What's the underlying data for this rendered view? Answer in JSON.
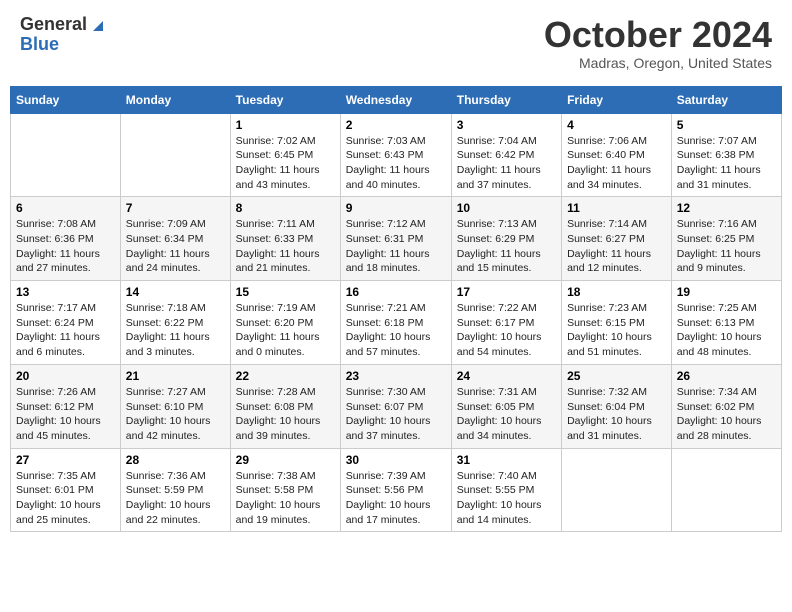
{
  "logo": {
    "general": "General",
    "blue": "Blue"
  },
  "title": "October 2024",
  "subtitle": "Madras, Oregon, United States",
  "days_of_week": [
    "Sunday",
    "Monday",
    "Tuesday",
    "Wednesday",
    "Thursday",
    "Friday",
    "Saturday"
  ],
  "weeks": [
    [
      {
        "day": "",
        "detail": ""
      },
      {
        "day": "",
        "detail": ""
      },
      {
        "day": "1",
        "detail": "Sunrise: 7:02 AM\nSunset: 6:45 PM\nDaylight: 11 hours and 43 minutes."
      },
      {
        "day": "2",
        "detail": "Sunrise: 7:03 AM\nSunset: 6:43 PM\nDaylight: 11 hours and 40 minutes."
      },
      {
        "day": "3",
        "detail": "Sunrise: 7:04 AM\nSunset: 6:42 PM\nDaylight: 11 hours and 37 minutes."
      },
      {
        "day": "4",
        "detail": "Sunrise: 7:06 AM\nSunset: 6:40 PM\nDaylight: 11 hours and 34 minutes."
      },
      {
        "day": "5",
        "detail": "Sunrise: 7:07 AM\nSunset: 6:38 PM\nDaylight: 11 hours and 31 minutes."
      }
    ],
    [
      {
        "day": "6",
        "detail": "Sunrise: 7:08 AM\nSunset: 6:36 PM\nDaylight: 11 hours and 27 minutes."
      },
      {
        "day": "7",
        "detail": "Sunrise: 7:09 AM\nSunset: 6:34 PM\nDaylight: 11 hours and 24 minutes."
      },
      {
        "day": "8",
        "detail": "Sunrise: 7:11 AM\nSunset: 6:33 PM\nDaylight: 11 hours and 21 minutes."
      },
      {
        "day": "9",
        "detail": "Sunrise: 7:12 AM\nSunset: 6:31 PM\nDaylight: 11 hours and 18 minutes."
      },
      {
        "day": "10",
        "detail": "Sunrise: 7:13 AM\nSunset: 6:29 PM\nDaylight: 11 hours and 15 minutes."
      },
      {
        "day": "11",
        "detail": "Sunrise: 7:14 AM\nSunset: 6:27 PM\nDaylight: 11 hours and 12 minutes."
      },
      {
        "day": "12",
        "detail": "Sunrise: 7:16 AM\nSunset: 6:25 PM\nDaylight: 11 hours and 9 minutes."
      }
    ],
    [
      {
        "day": "13",
        "detail": "Sunrise: 7:17 AM\nSunset: 6:24 PM\nDaylight: 11 hours and 6 minutes."
      },
      {
        "day": "14",
        "detail": "Sunrise: 7:18 AM\nSunset: 6:22 PM\nDaylight: 11 hours and 3 minutes."
      },
      {
        "day": "15",
        "detail": "Sunrise: 7:19 AM\nSunset: 6:20 PM\nDaylight: 11 hours and 0 minutes."
      },
      {
        "day": "16",
        "detail": "Sunrise: 7:21 AM\nSunset: 6:18 PM\nDaylight: 10 hours and 57 minutes."
      },
      {
        "day": "17",
        "detail": "Sunrise: 7:22 AM\nSunset: 6:17 PM\nDaylight: 10 hours and 54 minutes."
      },
      {
        "day": "18",
        "detail": "Sunrise: 7:23 AM\nSunset: 6:15 PM\nDaylight: 10 hours and 51 minutes."
      },
      {
        "day": "19",
        "detail": "Sunrise: 7:25 AM\nSunset: 6:13 PM\nDaylight: 10 hours and 48 minutes."
      }
    ],
    [
      {
        "day": "20",
        "detail": "Sunrise: 7:26 AM\nSunset: 6:12 PM\nDaylight: 10 hours and 45 minutes."
      },
      {
        "day": "21",
        "detail": "Sunrise: 7:27 AM\nSunset: 6:10 PM\nDaylight: 10 hours and 42 minutes."
      },
      {
        "day": "22",
        "detail": "Sunrise: 7:28 AM\nSunset: 6:08 PM\nDaylight: 10 hours and 39 minutes."
      },
      {
        "day": "23",
        "detail": "Sunrise: 7:30 AM\nSunset: 6:07 PM\nDaylight: 10 hours and 37 minutes."
      },
      {
        "day": "24",
        "detail": "Sunrise: 7:31 AM\nSunset: 6:05 PM\nDaylight: 10 hours and 34 minutes."
      },
      {
        "day": "25",
        "detail": "Sunrise: 7:32 AM\nSunset: 6:04 PM\nDaylight: 10 hours and 31 minutes."
      },
      {
        "day": "26",
        "detail": "Sunrise: 7:34 AM\nSunset: 6:02 PM\nDaylight: 10 hours and 28 minutes."
      }
    ],
    [
      {
        "day": "27",
        "detail": "Sunrise: 7:35 AM\nSunset: 6:01 PM\nDaylight: 10 hours and 25 minutes."
      },
      {
        "day": "28",
        "detail": "Sunrise: 7:36 AM\nSunset: 5:59 PM\nDaylight: 10 hours and 22 minutes."
      },
      {
        "day": "29",
        "detail": "Sunrise: 7:38 AM\nSunset: 5:58 PM\nDaylight: 10 hours and 19 minutes."
      },
      {
        "day": "30",
        "detail": "Sunrise: 7:39 AM\nSunset: 5:56 PM\nDaylight: 10 hours and 17 minutes."
      },
      {
        "day": "31",
        "detail": "Sunrise: 7:40 AM\nSunset: 5:55 PM\nDaylight: 10 hours and 14 minutes."
      },
      {
        "day": "",
        "detail": ""
      },
      {
        "day": "",
        "detail": ""
      }
    ]
  ]
}
